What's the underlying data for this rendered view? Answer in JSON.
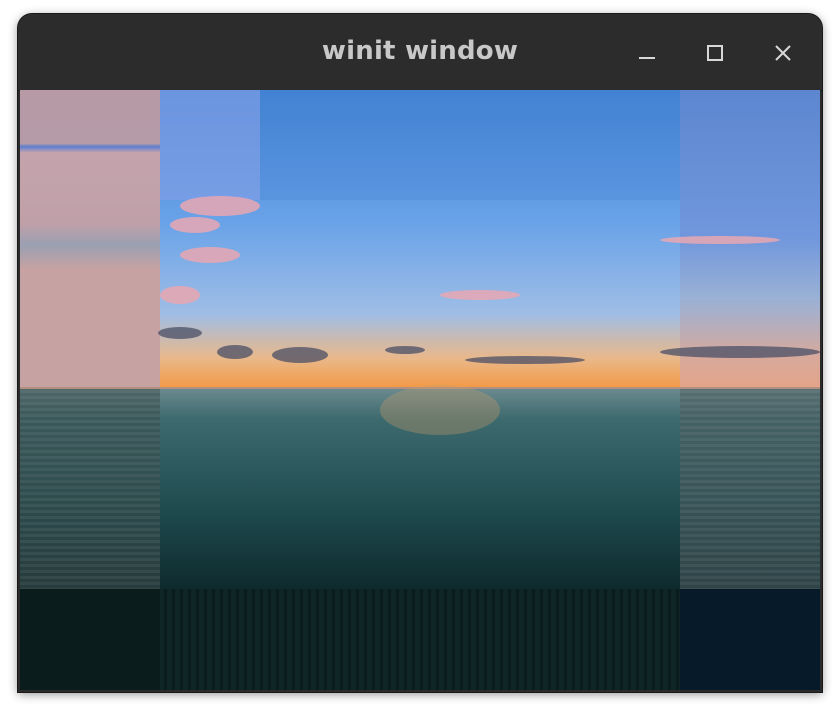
{
  "window": {
    "title": "winit window",
    "controls": {
      "minimize_icon": "minimize-icon",
      "maximize_icon": "maximize-icon",
      "close_icon": "close-icon"
    }
  },
  "content": {
    "image_subject": "sunset-over-ocean-photo",
    "colors": {
      "sky_top": "#4f86d4",
      "sky_mid": "#6fa3e6",
      "horizon_glow": "#f6a24a",
      "sea": "#1d4a4e",
      "sea_dark": "#0d2528"
    }
  }
}
